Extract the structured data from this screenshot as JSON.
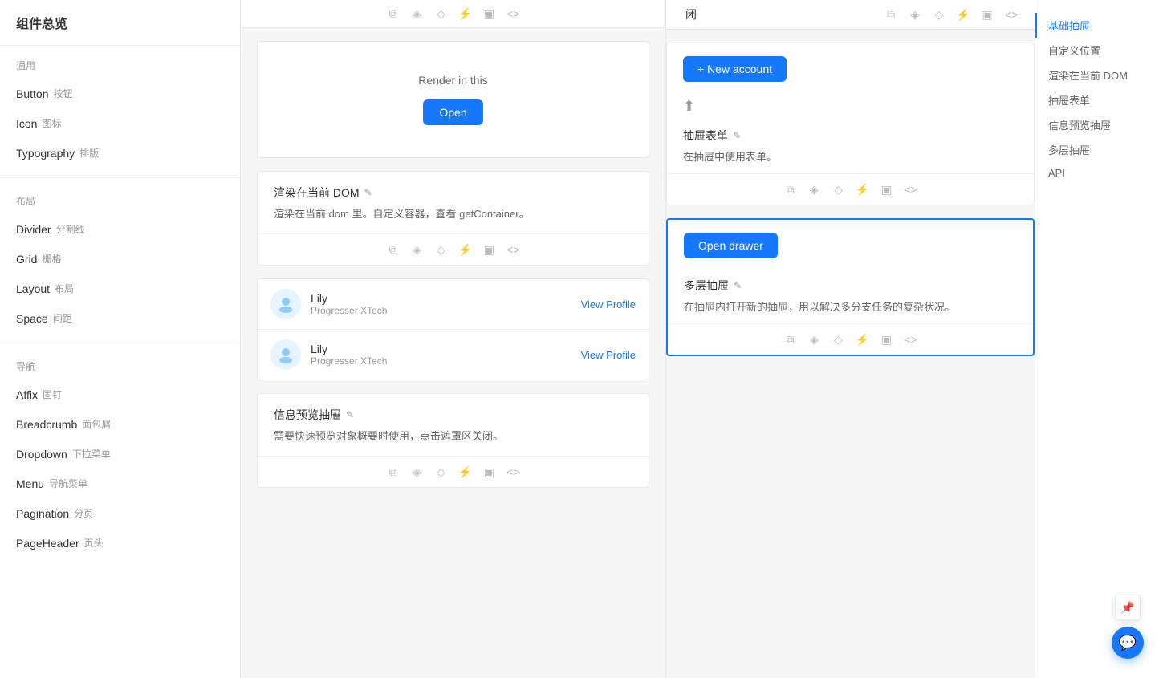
{
  "sidebar": {
    "title": "组件总览",
    "sections": [
      {
        "label": "通用",
        "items": [
          {
            "id": "button",
            "label": "Button",
            "secondary": "按钮"
          },
          {
            "id": "icon",
            "label": "Icon",
            "secondary": "图标"
          },
          {
            "id": "typography",
            "label": "Typography",
            "secondary": "排版"
          }
        ]
      },
      {
        "label": "布局",
        "items": [
          {
            "id": "divider",
            "label": "Divider",
            "secondary": "分割线"
          },
          {
            "id": "grid",
            "label": "Grid",
            "secondary": "栅格"
          },
          {
            "id": "layout",
            "label": "Layout",
            "secondary": "布局"
          },
          {
            "id": "space",
            "label": "Space",
            "secondary": "间距"
          }
        ]
      },
      {
        "label": "导航",
        "items": [
          {
            "id": "affix",
            "label": "Affix",
            "secondary": "固钉"
          },
          {
            "id": "breadcrumb",
            "label": "Breadcrumb",
            "secondary": "面包屑"
          },
          {
            "id": "dropdown",
            "label": "Dropdown",
            "secondary": "下拉菜单"
          },
          {
            "id": "menu",
            "label": "Menu",
            "secondary": "导航菜单"
          },
          {
            "id": "pagination",
            "label": "Pagination",
            "secondary": "分页"
          },
          {
            "id": "pageheader",
            "label": "PageHeader",
            "secondary": "页头"
          }
        ]
      }
    ]
  },
  "main": {
    "topToolbarIcons": [
      "copy",
      "cube",
      "diamond",
      "lightning",
      "file",
      "code"
    ],
    "renderInThis": {
      "text": "Render in this",
      "openButton": "Open"
    },
    "renderDOM": {
      "title": "渲染在当前 DOM",
      "editIcon": "✎",
      "desc": "渲染在当前 dom 里。自定义容器，查看 getContainer。"
    },
    "profileSection": {
      "profiles": [
        {
          "name": "Lily",
          "sub": "Progresser XTech",
          "link": "View Profile"
        },
        {
          "name": "Lily",
          "sub": "Progresser XTech",
          "link": "View Profile"
        }
      ]
    },
    "infoPreview": {
      "title": "信息预览抽屉",
      "editIcon": "✎",
      "desc": "需要快速预览对象概要时使用，点击遮罩区关闭。"
    }
  },
  "rightPanel": {
    "closedText": "闭",
    "newAccountButton": "+ New account",
    "drawerFormSection": {
      "title": "抽屉表单",
      "editIcon": "✎",
      "desc": "在抽屉中使用表单。"
    },
    "openDrawerButton": "Open drawer",
    "multiDrawer": {
      "title": "多层抽屉",
      "editIcon": "✎",
      "desc": "在抽屉内打开新的抽屉，用以解决多分支任务的复杂状况。"
    }
  },
  "toc": {
    "items": [
      {
        "id": "basic",
        "label": "基础抽屉",
        "active": true
      },
      {
        "id": "custom",
        "label": "自定义位置"
      },
      {
        "id": "renderdom",
        "label": "渲染在当前 DOM"
      },
      {
        "id": "drawerform",
        "label": "抽屉表单"
      },
      {
        "id": "infopreview",
        "label": "信息预览抽屉"
      },
      {
        "id": "multidrawer",
        "label": "多层抽屉"
      },
      {
        "id": "api",
        "label": "API"
      }
    ]
  },
  "floatBtn": {
    "icon": "💬"
  },
  "icons": {
    "copy": "⧉",
    "cube": "◈",
    "diamond": "◇",
    "lightning": "⚡",
    "file": "📄",
    "code": "<>"
  }
}
